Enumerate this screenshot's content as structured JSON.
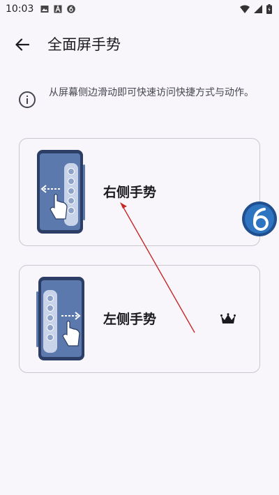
{
  "status_bar": {
    "time": "10:03",
    "left_icons": [
      "image-icon",
      "a-letter-icon",
      "six-badge-icon"
    ],
    "right_icons": [
      "wifi-icon",
      "cellular-icon",
      "battery-icon"
    ]
  },
  "app_bar": {
    "title": "全面屏手势",
    "back_icon": "arrow-back-icon"
  },
  "info": {
    "icon": "info-icon",
    "text": "从屏幕侧边滑动即可快速访问快捷方式与动作。"
  },
  "options": [
    {
      "label": "右侧手势",
      "illustration": "phone-right-gesture-icon",
      "premium": false
    },
    {
      "label": "左侧手势",
      "illustration": "phone-left-gesture-icon",
      "premium": true,
      "premium_icon": "crown-icon"
    }
  ],
  "colors": {
    "background": "#f8f6fb",
    "phone_blue": "#3d5a8a",
    "phone_dark": "#2c3e66",
    "arrow_red": "#c62828",
    "card_border": "#c9c7cf"
  }
}
